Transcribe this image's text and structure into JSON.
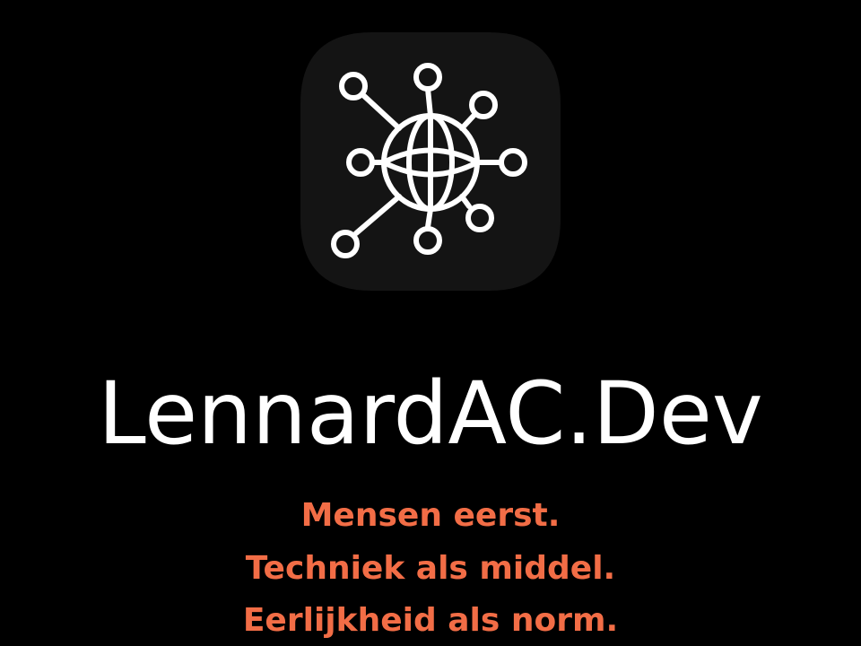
{
  "logo": {
    "icon": "network-globe-icon"
  },
  "brand": {
    "name": "LennardAC.Dev"
  },
  "taglines": [
    "Mensen eerst.",
    "Techniek als middel.",
    "Eerlijkheid als norm."
  ],
  "colors": {
    "background": "#000000",
    "logo_badge": "#141414",
    "brand_text": "#ffffff",
    "accent": "#f26d46"
  }
}
